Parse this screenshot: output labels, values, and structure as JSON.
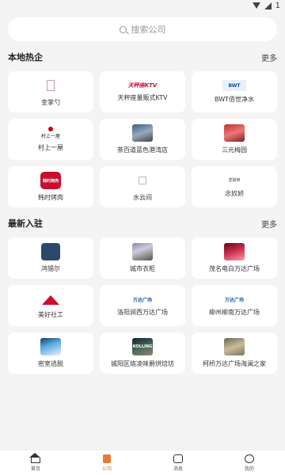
{
  "status_bar": {
    "right_text": "1"
  },
  "search": {
    "placeholder": "搜索公司"
  },
  "sections": {
    "local": {
      "title": "本地热企",
      "more": "更多",
      "items": [
        {
          "name": "金掌勺",
          "icon": "jinzhangshao-logo"
        },
        {
          "name": "天秤座量贩式KTV",
          "icon": "ktv-logo",
          "logo_text": "天秤座KTV"
        },
        {
          "name": "BWT佰世净水",
          "icon": "bwt-logo",
          "logo_text": "BWT"
        },
        {
          "name": "村上一屋",
          "icon": "cunshang-logo",
          "logo_text": "村上一屋"
        },
        {
          "name": "茶百道蓝色港湾店",
          "icon": "chabaidao-photo"
        },
        {
          "name": "三元梅园",
          "icon": "sanyuan-photo"
        },
        {
          "name": "韩时烤肉",
          "icon": "hanshi-logo",
          "logo_text": "韩时烤肉"
        },
        {
          "name": "水云间",
          "icon": "shuiyunjian-logo"
        },
        {
          "name": "念奴娇",
          "icon": "niannujiao-logo",
          "logo_text": "念奴娇"
        }
      ]
    },
    "new": {
      "title": "最新入驻",
      "more": "更多",
      "items": [
        {
          "name": "鸿锡尔",
          "icon": "hongxier-logo"
        },
        {
          "name": "城市衣柜",
          "icon": "chengshi-photo"
        },
        {
          "name": "茂名电白万达广场",
          "icon": "maoming-photo"
        },
        {
          "name": "美好社工",
          "icon": "meihao-logo"
        },
        {
          "name": "洛阳涧西万达广场",
          "icon": "wanda-logo",
          "logo_text": "万达广场"
        },
        {
          "name": "柳州柳南万达广场",
          "icon": "wanda-logo",
          "logo_text": "万达广场"
        },
        {
          "name": "密室逃脱",
          "icon": "mishi-photo"
        },
        {
          "name": "城阳区烙凌味爵烘焙坊",
          "icon": "bakery-photo",
          "logo_text": "KOLLING"
        },
        {
          "name": "柯桥万达广场海澜之家",
          "icon": "heilan-photo"
        }
      ]
    }
  },
  "tabbar": [
    {
      "label": "首页",
      "icon": "home-icon",
      "active": false
    },
    {
      "label": "公司",
      "icon": "company-icon",
      "active": true
    },
    {
      "label": "消息",
      "icon": "chat-icon",
      "active": false
    },
    {
      "label": "我的",
      "icon": "person-icon",
      "active": false
    }
  ],
  "colors": {
    "accent": "#e87a3a",
    "background": "#f4f4f4",
    "card": "#ffffff"
  }
}
